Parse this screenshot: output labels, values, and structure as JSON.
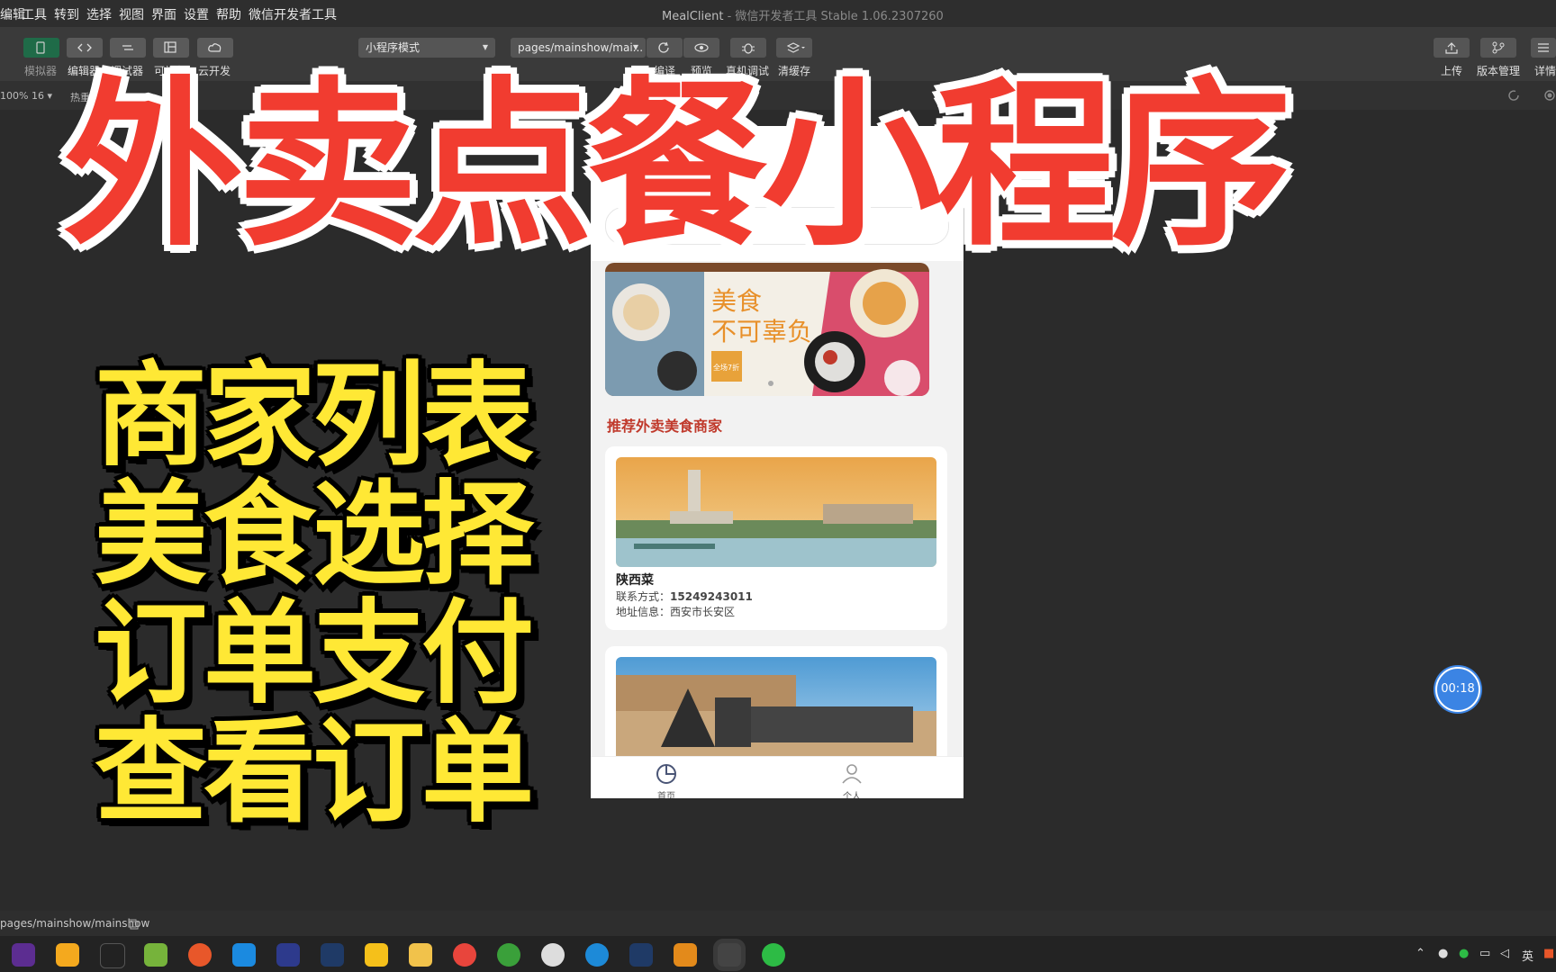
{
  "menubar": {
    "items": [
      "编辑",
      "工具",
      "转到",
      "选择",
      "视图",
      "界面",
      "设置",
      "帮助",
      "微信开发者工具"
    ],
    "app_name": "MealClient",
    "title_rest": " - 微信开发者工具 Stable 1.06.2307260"
  },
  "toolbar": {
    "left_labels": [
      "模拟器",
      "编辑器",
      "调试器",
      "可视化",
      "云开发"
    ],
    "mode_select": "小程序模式",
    "page_select": "pages/mainshow/mai...",
    "mid_labels": [
      "编译",
      "预览",
      "真机调试",
      "清缓存"
    ],
    "right_labels": [
      "上传",
      "版本管理",
      "详情"
    ]
  },
  "subbar": {
    "zoom": "100% 16 ▾",
    "hot": "热重"
  },
  "overlay": {
    "title": "外卖点餐小程序",
    "features": [
      "商家列表",
      "美食选择",
      "订单支付",
      "查看订单"
    ]
  },
  "simulator": {
    "capsule": "•••",
    "section_title": "推荐外卖美食商家",
    "banner_text": [
      "美食",
      "不可辜负"
    ],
    "banner_badge": "全场7折",
    "shops": [
      {
        "name": "陕西菜",
        "contact_label": "联系方式：",
        "phone": "15249243011",
        "address_label": "地址信息：",
        "address": "西安市长安区"
      },
      {
        "name": "",
        "contact_label": "",
        "phone": "",
        "address_label": "",
        "address": ""
      }
    ],
    "tabs": [
      "首页",
      "个人"
    ]
  },
  "timer": "00:18",
  "status": {
    "path": "pages/mainshow/mainshow"
  },
  "tray": {
    "lang": "英"
  },
  "colors": {
    "title_red": "#f13c30",
    "feature_yellow": "#ffe835",
    "section_red": "#c0392b",
    "timer_blue": "#3b84e4"
  }
}
